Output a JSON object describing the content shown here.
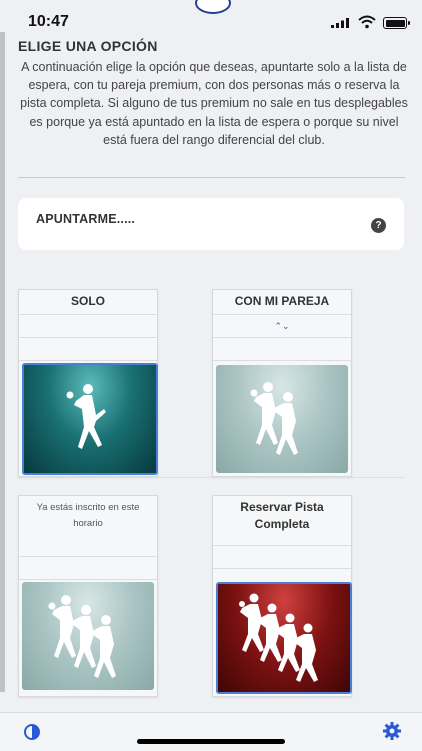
{
  "status_bar": {
    "time": "10:47"
  },
  "section": {
    "title": "ELIGE UNA OPCIÓN",
    "description": "A continuación elige la opción que deseas, apuntarte solo a la lista de espera, con tu pareja premium, con dos personas más o reserva la pista completa. Si alguno de tus premium no sale en tus desplegables es porque ya está apuntado en la lista de espera o porque su nivel está fuera del rango diferencial del club."
  },
  "apuntarme": {
    "label": "APUNTARME.....",
    "help_icon": "?"
  },
  "options": [
    {
      "title": "SOLO",
      "image": "player-single",
      "color": "#0f5a5e"
    },
    {
      "title": "CON MI PAREJA",
      "image": "players-pair",
      "color": "#9fb9b8",
      "selector": "⌃⌄"
    },
    {
      "title": "Ya estás inscrito en este horario",
      "image": "players-three",
      "color": "#9fb9b8"
    },
    {
      "title": "Reservar Pista Completa",
      "image": "players-four",
      "color": "#8e1616"
    }
  ],
  "colors": {
    "accent": "#2a59d6",
    "selected_border": "#4a7fd8"
  }
}
